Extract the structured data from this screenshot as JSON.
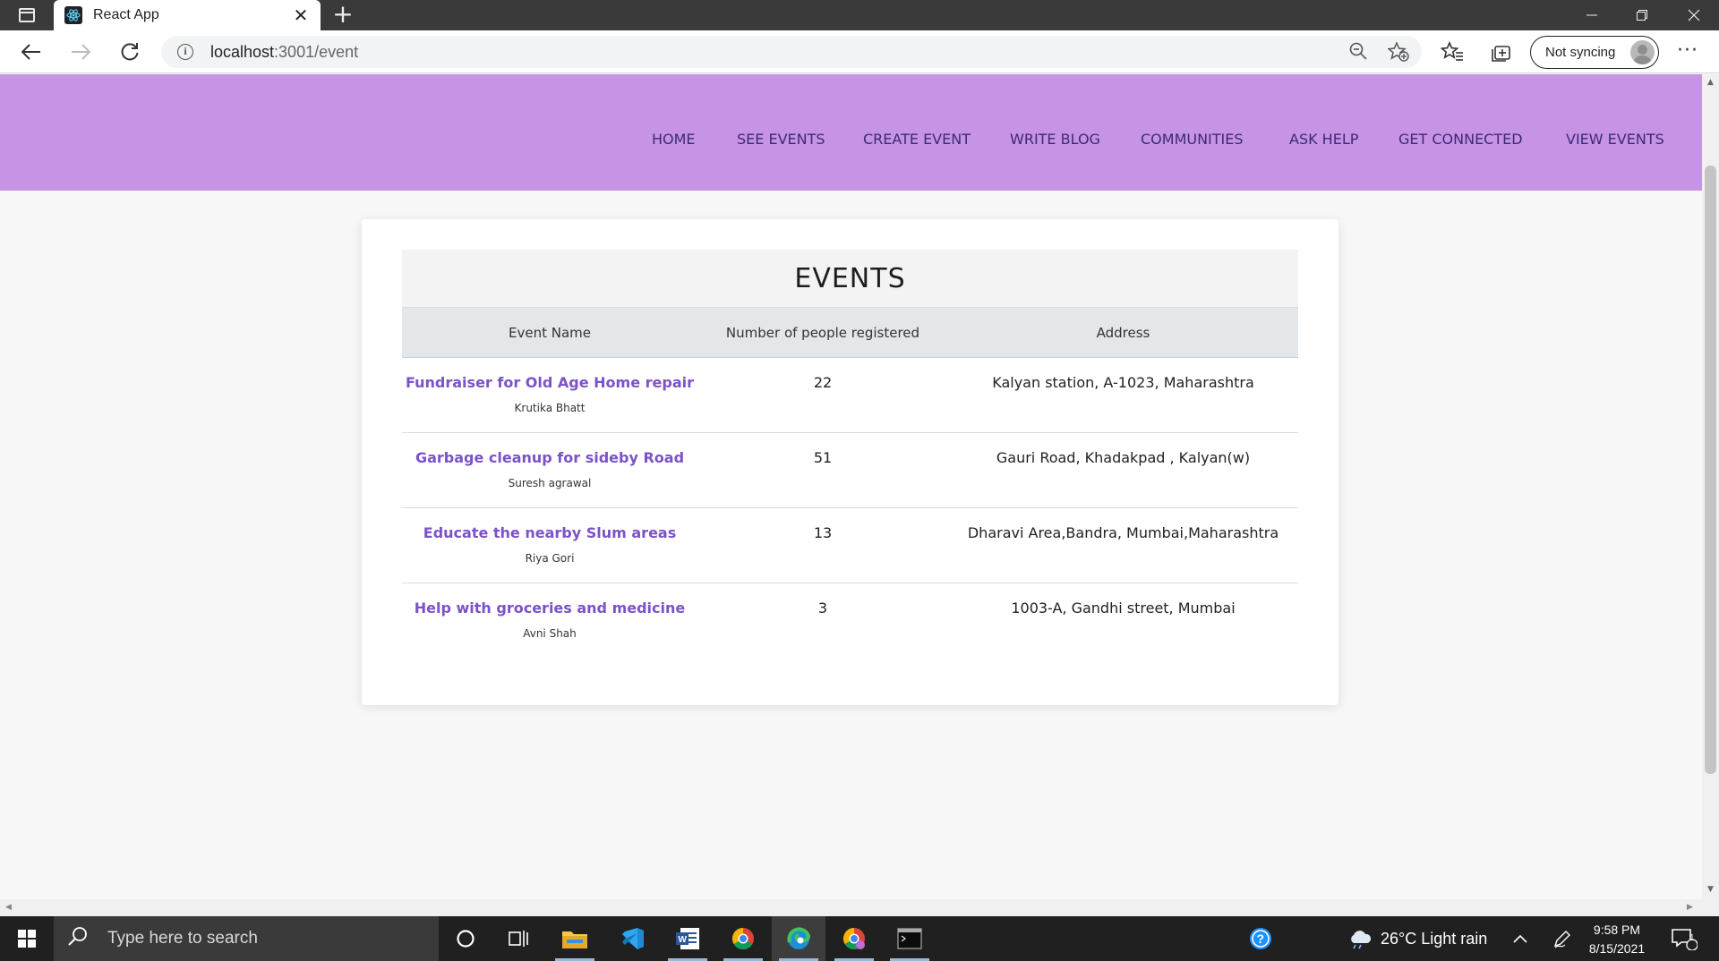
{
  "browser": {
    "tab_title": "React App",
    "new_tab_glyph": "+",
    "url_host": "localhost",
    "url_path": ":3001/event",
    "sync_label": "Not syncing"
  },
  "site_nav": {
    "links": [
      "HOME",
      "SEE EVENTS",
      "CREATE EVENT",
      "WRITE BLOG",
      "COMMUNITIES",
      "ASK HELP",
      "GET CONNECTED",
      "VIEW EVENTS"
    ],
    "background": "#c793e4",
    "link_color": "#3c2a78"
  },
  "events": {
    "title": "EVENTS",
    "headers": [
      "Event Name",
      "Number of people registered",
      "Address"
    ],
    "rows": [
      {
        "name": "Fundraiser for Old Age Home repair",
        "organizer": "Krutika Bhatt",
        "registered": "22",
        "address": "Kalyan station, A-1023, Maharashtra"
      },
      {
        "name": "Garbage cleanup for sideby Road",
        "organizer": "Suresh agrawal",
        "registered": "51",
        "address": "Gauri Road, Khadakpad , Kalyan(w)"
      },
      {
        "name": "Educate the nearby Slum areas",
        "organizer": "Riya Gori",
        "registered": "13",
        "address": "Dharavi Area,Bandra, Mumbai,Maharashtra"
      },
      {
        "name": "Help with groceries and medicine",
        "organizer": "Avni Shah",
        "registered": "3",
        "address": "1003-A, Gandhi street, Mumbai"
      }
    ],
    "link_color": "#7b52c8"
  },
  "taskbar": {
    "search_placeholder": "Type here to search",
    "weather": "26°C  Light rain",
    "time": "9:58 PM",
    "date": "8/15/2021",
    "notification_count": "1"
  }
}
